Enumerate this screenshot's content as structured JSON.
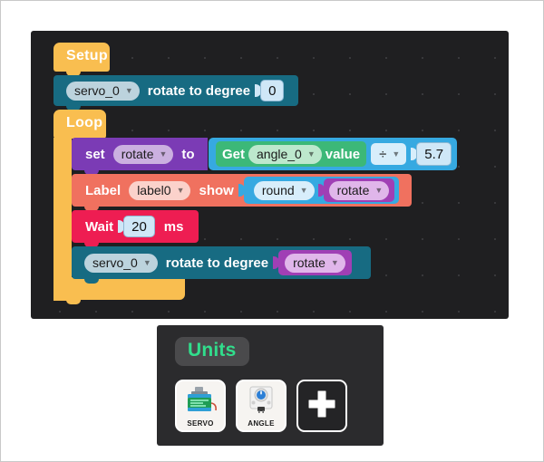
{
  "workspace": {
    "setup": {
      "label": "Setup"
    },
    "loop": {
      "label": "Loop"
    },
    "setup_servo": {
      "device": "servo_0",
      "action": "rotate to degree",
      "value": "0"
    },
    "set_rotate": {
      "keyword": "set",
      "variable": "rotate",
      "to": "to",
      "get_word": "Get",
      "sensor": "angle_0",
      "value_word": "value",
      "operator": "÷",
      "operand": "5.7"
    },
    "label_show": {
      "keyword": "Label",
      "target": "label0",
      "action": "show",
      "func": "round",
      "variable": "rotate"
    },
    "wait": {
      "keyword": "Wait",
      "value": "20",
      "unit": "ms"
    },
    "loop_servo": {
      "device": "servo_0",
      "action": "rotate to degree",
      "variable": "rotate"
    }
  },
  "units": {
    "title": "Units",
    "cards": [
      {
        "caption": "SERVO",
        "icon": "servo-motor-icon"
      },
      {
        "caption": "ANGLE",
        "icon": "angle-sensor-icon"
      }
    ],
    "add_label": "+",
    "add_icon": "plus-icon"
  },
  "colors": {
    "hat": "#f9be50",
    "servo": "#176b82",
    "variable_set": "#7b3bb5",
    "label": "#f0715f",
    "wait": "#ee1d52",
    "math": "#36a9e1",
    "sensor_get": "#3cb878",
    "variable_reporter": "#a03fb5",
    "units_accent": "#31de8c",
    "canvas": "#1f1f21"
  }
}
